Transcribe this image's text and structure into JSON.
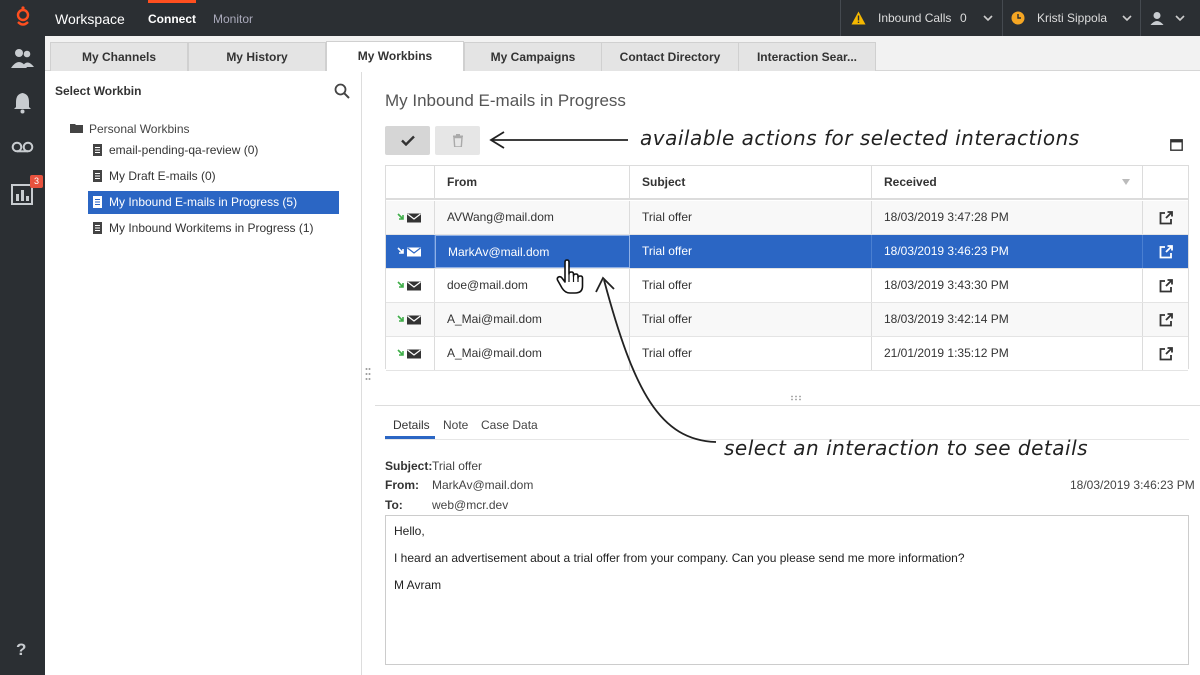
{
  "topbar": {
    "brand": "Workspace",
    "nav_connect": "Connect",
    "nav_monitor": "Monitor",
    "inbound_calls_label": "Inbound Calls",
    "inbound_calls_count": "0",
    "user_name": "Kristi Sippola"
  },
  "rail": {
    "reports_badge": "3",
    "help_label": "?"
  },
  "tabs": [
    {
      "label": "My Channels"
    },
    {
      "label": "My History"
    },
    {
      "label": "My Workbins"
    },
    {
      "label": "My Campaigns"
    },
    {
      "label": "Contact Directory"
    },
    {
      "label": "Interaction Sear..."
    }
  ],
  "workbins": {
    "title": "Select Workbin",
    "root": "Personal Workbins",
    "items": [
      {
        "label": "email-pending-qa-review (0)"
      },
      {
        "label": "My Draft E-mails (0)"
      },
      {
        "label": "My Inbound E-mails in Progress (5)"
      },
      {
        "label": "My Inbound Workitems in Progress (1)"
      }
    ]
  },
  "main": {
    "title": "My Inbound E-mails in Progress"
  },
  "grid": {
    "columns": [
      "From",
      "Subject",
      "Received"
    ],
    "rows": [
      {
        "from": "AVWang@mail.dom",
        "subject": "Trial offer",
        "received": "18/03/2019 3:47:28 PM"
      },
      {
        "from": "MarkAv@mail.dom",
        "subject": "Trial offer",
        "received": "18/03/2019 3:46:23 PM"
      },
      {
        "from": "doe@mail.dom",
        "subject": "Trial offer",
        "received": "18/03/2019 3:43:30 PM"
      },
      {
        "from": "A_Mai@mail.dom",
        "subject": "Trial offer",
        "received": "18/03/2019 3:42:14 PM"
      },
      {
        "from": "A_Mai@mail.dom",
        "subject": "Trial offer",
        "received": "21/01/2019 1:35:12 PM"
      }
    ]
  },
  "details": {
    "tabs": [
      "Details",
      "Note",
      "Case Data"
    ],
    "subject_label": "Subject:",
    "subject": "Trial offer",
    "from_label": "From:",
    "from": "MarkAv@mail.dom",
    "to_label": "To:",
    "to": "web@mcr.dev",
    "date": "18/03/2019 3:46:23 PM",
    "body": [
      "Hello,",
      "I heard an advertisement about a trial offer from your company. Can you please send me more information?",
      "M Avram"
    ]
  },
  "annotations": {
    "actions": "available actions for selected interactions",
    "select": "select an interaction to see details"
  },
  "colors": {
    "topbar_bg": "#2b2f33",
    "accent_orange": "#ff4f1f",
    "selection_blue": "#2b66c4",
    "warning_yellow": "#f5b800",
    "status_orange": "#f5a623",
    "inbound_green": "#3fae49"
  }
}
